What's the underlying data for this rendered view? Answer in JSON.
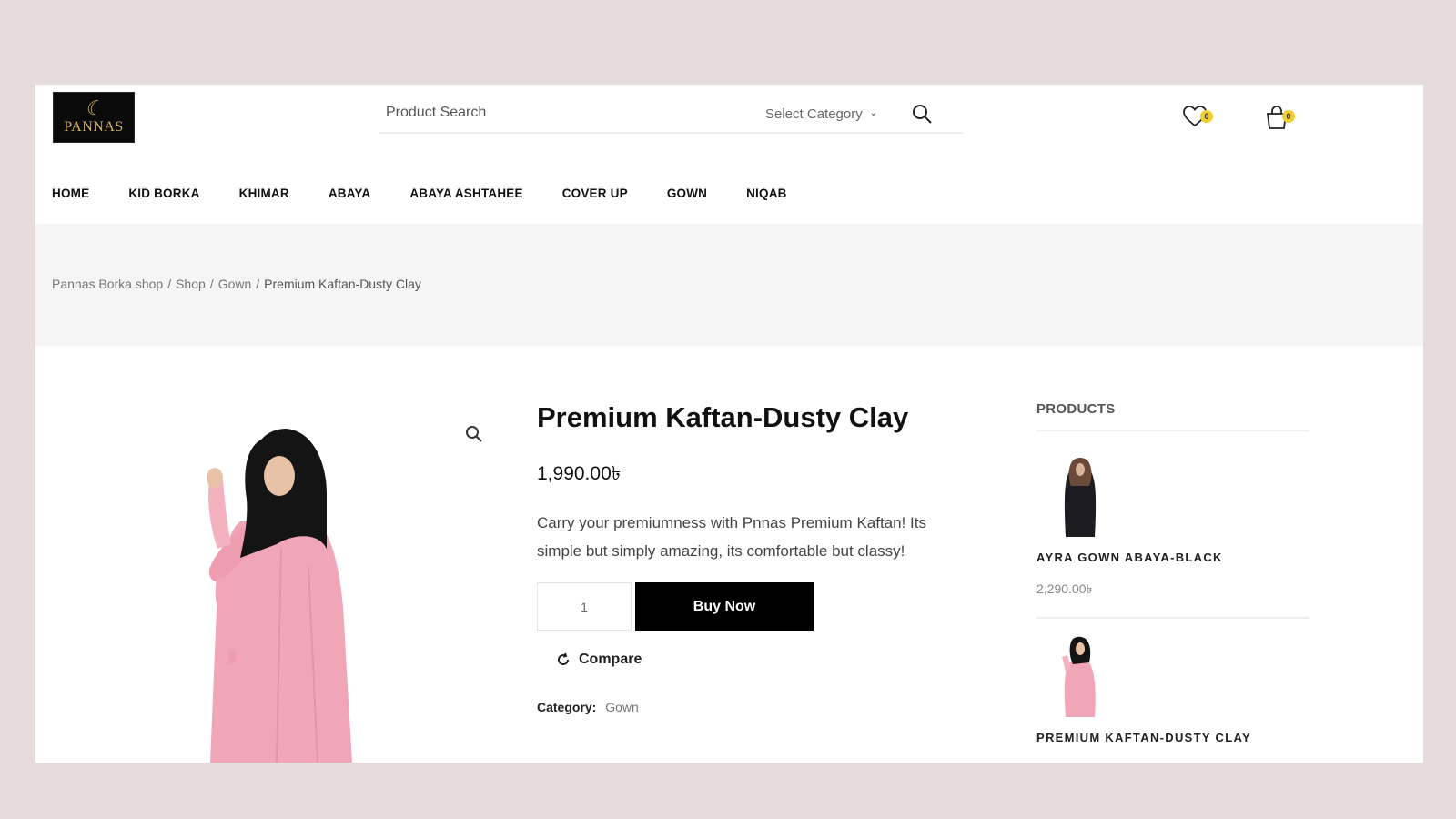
{
  "header": {
    "logo_text": "PANNAS",
    "search_placeholder": "Product Search",
    "category_select": "Select Category",
    "wishlist_count": "0",
    "cart_count": "0"
  },
  "nav": [
    "HOME",
    "KID BORKA",
    "KHIMAR",
    "ABAYA",
    "ABAYA ASHTAHEE",
    "COVER UP",
    "GOWN",
    "NIQAB"
  ],
  "breadcrumb": [
    "Pannas Borka shop",
    "/",
    "Shop",
    "/",
    "Gown",
    "/",
    "Premium Kaftan-Dusty Clay"
  ],
  "product": {
    "title": "Premium Kaftan-Dusty Clay",
    "price": "1,990.00৳",
    "description": "Carry your premiumness with Pnnas Premium Kaftan! Its simple but simply amazing, its comfortable but classy!",
    "quantity": "1",
    "buy_label": "Buy Now",
    "compare_label": "Compare",
    "category_label": "Category:",
    "category_value": "Gown"
  },
  "sidebar": {
    "heading": "PRODUCTS",
    "items": [
      {
        "name": "AYRA GOWN ABAYA-BLACK",
        "price": "2,290.00৳"
      },
      {
        "name": "PREMIUM KAFTAN-DUSTY CLAY"
      }
    ]
  },
  "colors": {
    "page_bg": "#e7dcdc",
    "buy_button": "#000000",
    "badge": "#f2cd2e",
    "dress_pink": "#f1a6b8"
  },
  "icons": [
    "search-icon",
    "heart-icon",
    "shopping-bag-icon",
    "zoom-icon",
    "refresh-icon",
    "chevron-down-icon"
  ]
}
